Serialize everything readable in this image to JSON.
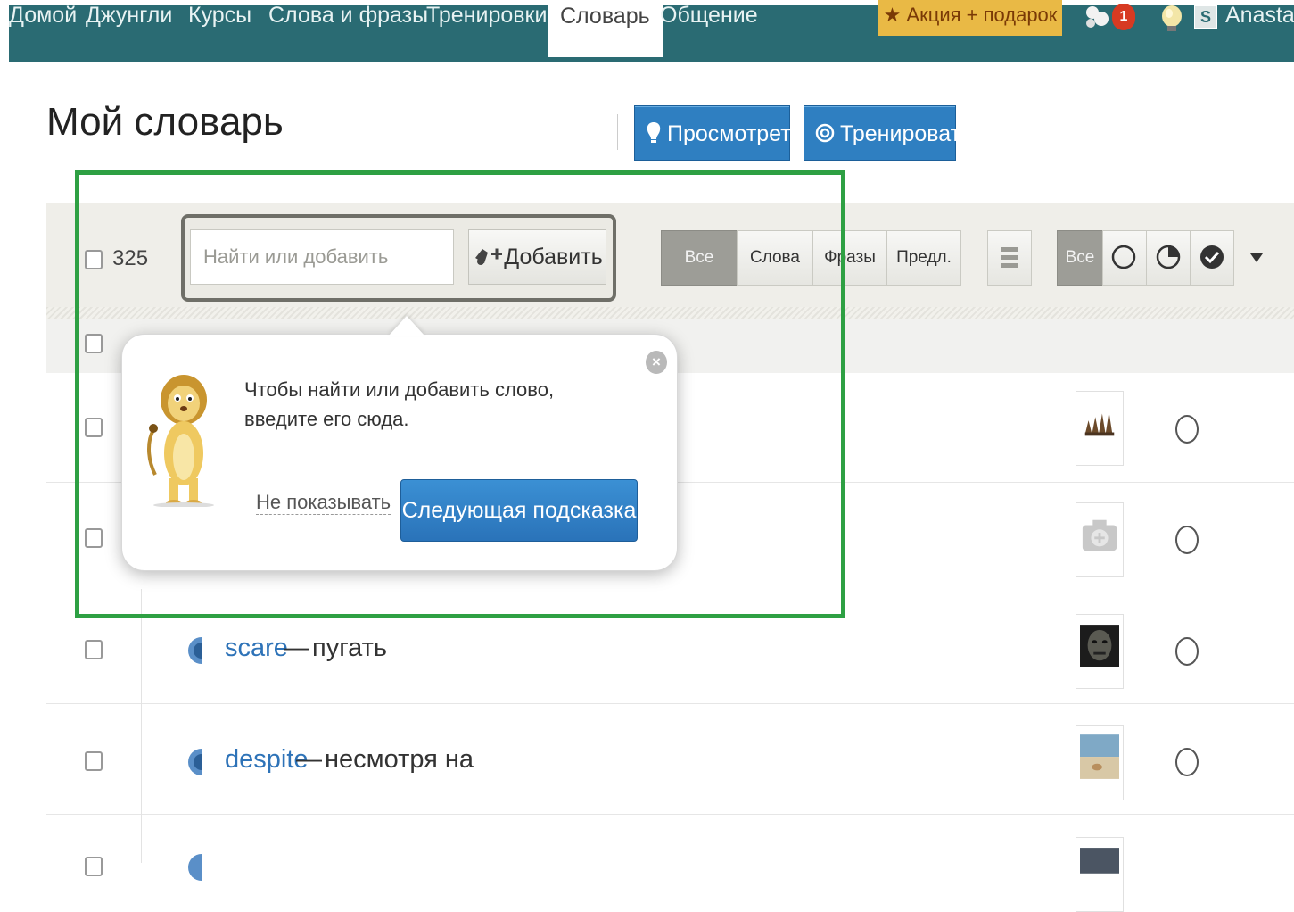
{
  "nav": {
    "items": [
      "Домой",
      "Джунгли",
      "Курсы",
      "Слова и фразы",
      "Тренировки",
      "Словарь",
      "Общение"
    ],
    "promo": "★ Акция + подарок",
    "notif_count": "1",
    "s_letter": "S",
    "username": "Anasta"
  },
  "page": {
    "title": "Мой словарь",
    "view_button": "Просмотреть",
    "train_button": "Тренировать"
  },
  "toolbar": {
    "count": "325",
    "search_placeholder": "Найти или добавить",
    "add_button": "Добавить",
    "type_filters": [
      "Все",
      "Слова",
      "Фразы",
      "Предл."
    ],
    "status_all": "Все"
  },
  "popup": {
    "text": "Чтобы найти или добавить слово, введите его сюда.",
    "dont_show": "Не показывать",
    "next_hint": "Следующая подсказка",
    "close_glyph": "×"
  },
  "words": [
    {
      "word": "scare",
      "dash": "—",
      "translation": "пугать"
    },
    {
      "word": "despite",
      "dash": "—",
      "translation": "несмотря на"
    }
  ],
  "colors": {
    "nav_bg": "#2a6b73",
    "accent_blue": "#2f7fc1",
    "highlight_green": "#2ea043",
    "word_link": "#2e73b8"
  }
}
